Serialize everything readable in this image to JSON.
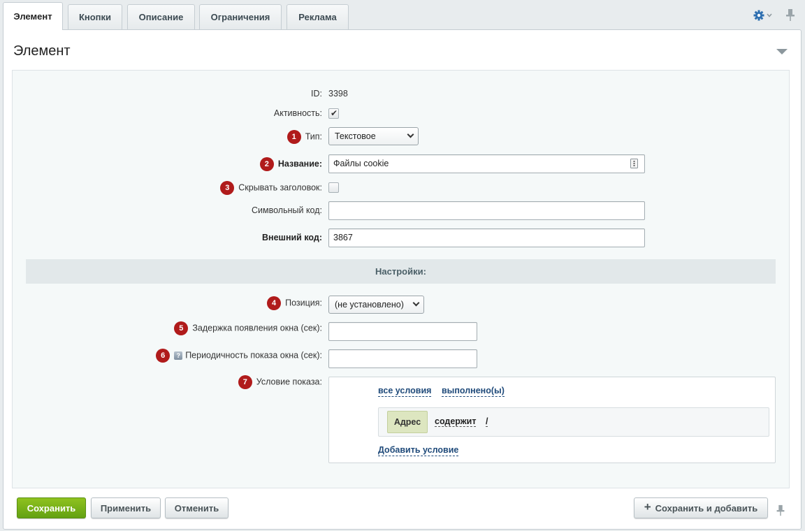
{
  "tabs": [
    {
      "label": "Элемент",
      "active": true
    },
    {
      "label": "Кнопки"
    },
    {
      "label": "Описание"
    },
    {
      "label": "Ограничения"
    },
    {
      "label": "Реклама"
    }
  ],
  "panel": {
    "title": "Элемент"
  },
  "form": {
    "id_label": "ID:",
    "id_value": "3398",
    "active_label": "Активность:",
    "active_checked": true,
    "type_label": "Тип:",
    "type_value": "Текстовое",
    "name_label": "Название:",
    "name_value": "Файлы cookie",
    "hide_title_label": "Скрывать заголовок:",
    "hide_title_checked": false,
    "code_label": "Символьный код:",
    "code_value": "",
    "ext_code_label": "Внешний код:",
    "ext_code_value": "3867"
  },
  "settings": {
    "section_title": "Настройки:",
    "position_label": "Позиция:",
    "position_value": "(не установлено)",
    "delay_label": "Задержка появления окна (сек):",
    "delay_value": "",
    "period_label": "Периодичность показа окна (сек):",
    "period_value": "",
    "condition_label": "Условие показа:",
    "condition": {
      "all_link": "все условия",
      "done_link": "выполнено(ы)",
      "rule_field": "Адрес",
      "rule_op": "содержит",
      "rule_value": "/",
      "add_link": "Добавить условие"
    }
  },
  "badges": [
    "1",
    "2",
    "3",
    "4",
    "5",
    "6",
    "7"
  ],
  "buttons": {
    "save": "Сохранить",
    "apply": "Применить",
    "cancel": "Отменить",
    "save_add": "Сохранить и добавить",
    "plus": "+"
  },
  "icons": {
    "help": "?",
    "field_menu": "dots"
  },
  "colors": {
    "accent_green": "#7ab51d",
    "badge_red": "#b01b1b",
    "link_blue": "#1f4a7a",
    "gear_blue": "#2e6fb0"
  }
}
